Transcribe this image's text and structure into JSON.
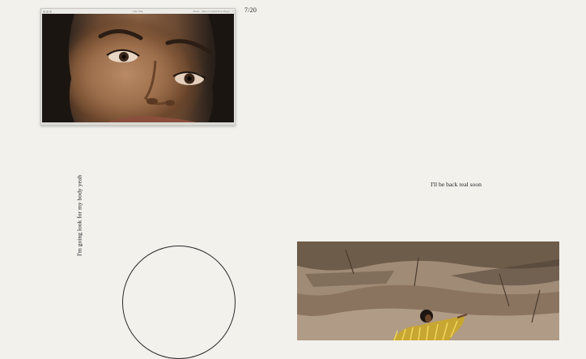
{
  "window": {
    "title": "Film Title",
    "toolbar_right": "Share  ·  Open in QuickTime Player"
  },
  "page_counter": "7/20",
  "vertical_caption": "I'm going look for my body yeah",
  "side_caption": "I'll be back real soon",
  "colors": {
    "background": "#f2f1ec",
    "text": "#1f1f1f",
    "circle_stroke": "#2a2a2a"
  },
  "images": {
    "video_still": "Close-up of a woman's face",
    "photo": "Woman with gold fringed cape before sandstone cliffs"
  }
}
